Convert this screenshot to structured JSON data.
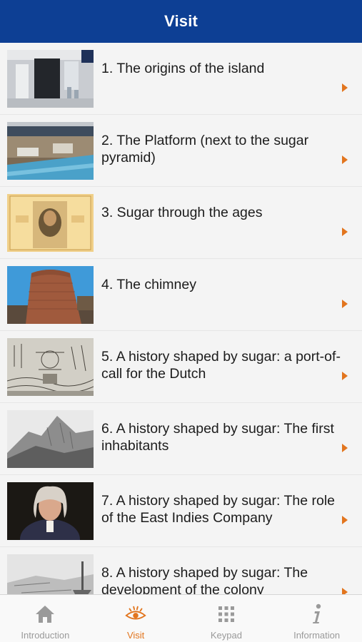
{
  "header": {
    "title": "Visit"
  },
  "items": [
    {
      "label": "1. The origins of the island"
    },
    {
      "label": "2. The Platform (next to the sugar pyramid)"
    },
    {
      "label": "3. Sugar through the ages"
    },
    {
      "label": "4. The chimney"
    },
    {
      "label": "5. A history shaped by sugar: a port-of-call for the Dutch"
    },
    {
      "label": "6. A history shaped by sugar: The first inhabitants"
    },
    {
      "label": "7. A history shaped by sugar: The role of the East Indies Company"
    },
    {
      "label": "8. A history shaped by sugar: The development of the colony"
    }
  ],
  "tabs": [
    {
      "label": "Introduction",
      "icon": "home-icon"
    },
    {
      "label": "Visit",
      "icon": "eye-icon",
      "active": true
    },
    {
      "label": "Keypad",
      "icon": "keypad-icon"
    },
    {
      "label": "Information",
      "icon": "info-icon"
    }
  ],
  "colors": {
    "header": "#0d3f94",
    "accent": "#e2751e",
    "inactive": "#9a9a9a"
  }
}
